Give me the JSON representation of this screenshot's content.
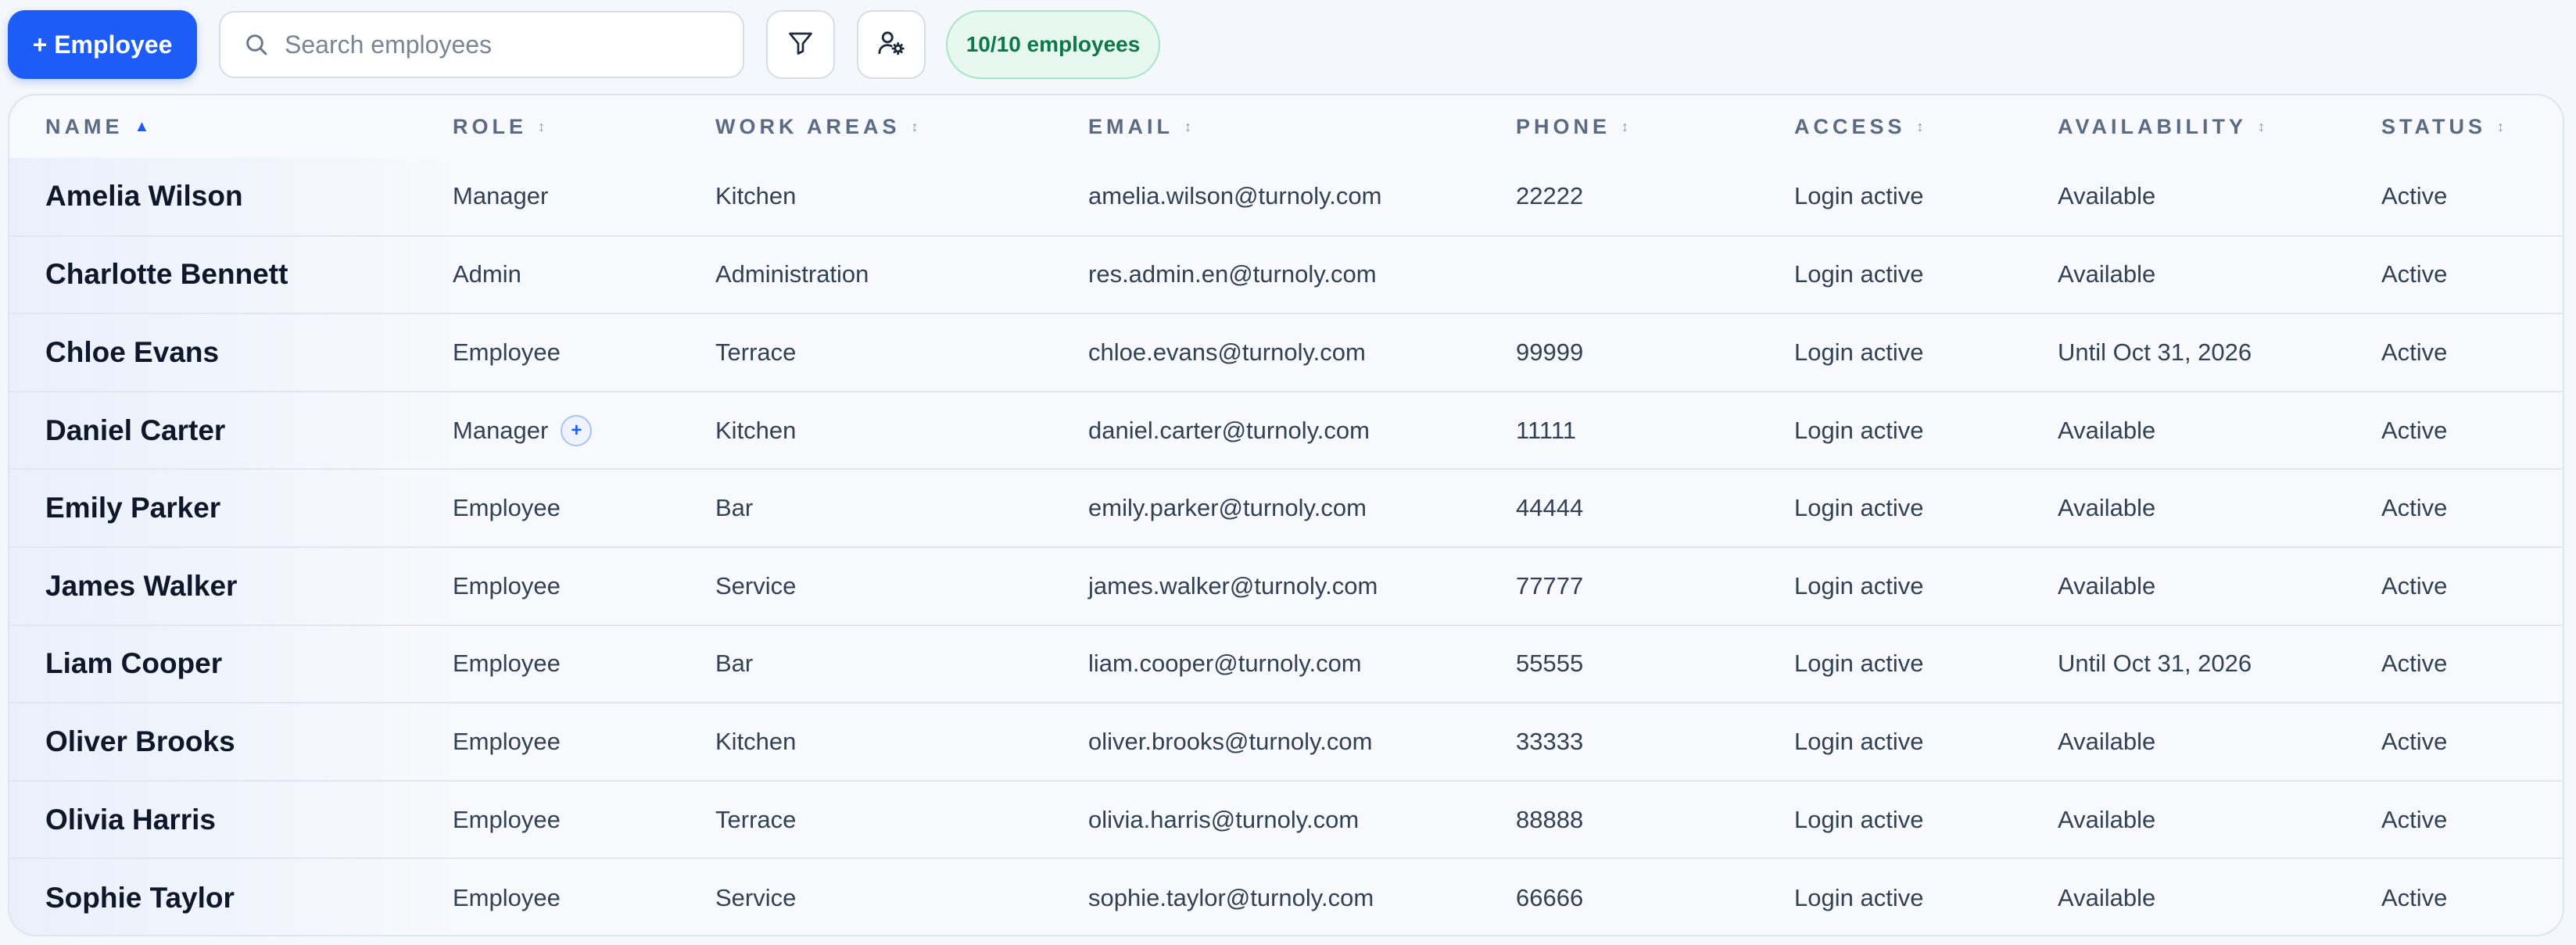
{
  "toolbar": {
    "add_button_label": "+ Employee",
    "search_placeholder": "Search employees",
    "filter_icon": "filter-icon",
    "manage_icon": "user-settings-icon",
    "count_badge": "10/10 employees"
  },
  "table": {
    "columns": [
      {
        "label": "NAME",
        "sort": "▲"
      },
      {
        "label": "ROLE",
        "sort": "↕"
      },
      {
        "label": "WORK AREAS",
        "sort": "↕"
      },
      {
        "label": "EMAIL",
        "sort": "↕"
      },
      {
        "label": "PHONE",
        "sort": "↕"
      },
      {
        "label": "ACCESS",
        "sort": "↕"
      },
      {
        "label": "AVAILABILITY",
        "sort": "↕"
      },
      {
        "label": "STATUS",
        "sort": "↕"
      }
    ],
    "rows": [
      {
        "name": "Amelia Wilson",
        "role": "Manager",
        "work_areas": "Kitchen",
        "email": "amelia.wilson@turnoly.com",
        "phone": "22222",
        "access": "Login active",
        "availability": "Available",
        "status": "Active"
      },
      {
        "name": "Charlotte Bennett",
        "role": "Admin",
        "work_areas": "Administration",
        "email": "res.admin.en@turnoly.com",
        "phone": "",
        "access": "Login active",
        "availability": "Available",
        "status": "Active"
      },
      {
        "name": "Chloe Evans",
        "role": "Employee",
        "work_areas": "Terrace",
        "email": "chloe.evans@turnoly.com",
        "phone": "99999",
        "access": "Login active",
        "availability": "Until Oct 31, 2026",
        "status": "Active"
      },
      {
        "name": "Daniel Carter",
        "role": "Manager",
        "role_extra": "+",
        "work_areas": "Kitchen",
        "email": "daniel.carter@turnoly.com",
        "phone": "11111",
        "access": "Login active",
        "availability": "Available",
        "status": "Active"
      },
      {
        "name": "Emily Parker",
        "role": "Employee",
        "work_areas": "Bar",
        "email": "emily.parker@turnoly.com",
        "phone": "44444",
        "access": "Login active",
        "availability": "Available",
        "status": "Active"
      },
      {
        "name": "James Walker",
        "role": "Employee",
        "work_areas": "Service",
        "email": "james.walker@turnoly.com",
        "phone": "77777",
        "access": "Login active",
        "availability": "Available",
        "status": "Active"
      },
      {
        "name": "Liam Cooper",
        "role": "Employee",
        "work_areas": "Bar",
        "email": "liam.cooper@turnoly.com",
        "phone": "55555",
        "access": "Login active",
        "availability": "Until Oct 31, 2026",
        "status": "Active"
      },
      {
        "name": "Oliver Brooks",
        "role": "Employee",
        "work_areas": "Kitchen",
        "email": "oliver.brooks@turnoly.com",
        "phone": "33333",
        "access": "Login active",
        "availability": "Available",
        "status": "Active"
      },
      {
        "name": "Olivia Harris",
        "role": "Employee",
        "work_areas": "Terrace",
        "email": "olivia.harris@turnoly.com",
        "phone": "88888",
        "access": "Login active",
        "availability": "Available",
        "status": "Active"
      },
      {
        "name": "Sophie Taylor",
        "role": "Employee",
        "work_areas": "Service",
        "email": "sophie.taylor@turnoly.com",
        "phone": "66666",
        "access": "Login active",
        "availability": "Available",
        "status": "Active"
      }
    ]
  },
  "colors": {
    "accent": "#1d5cf6",
    "badge_text": "#0b7a4a",
    "badge_bg": "#e6f8ef"
  }
}
